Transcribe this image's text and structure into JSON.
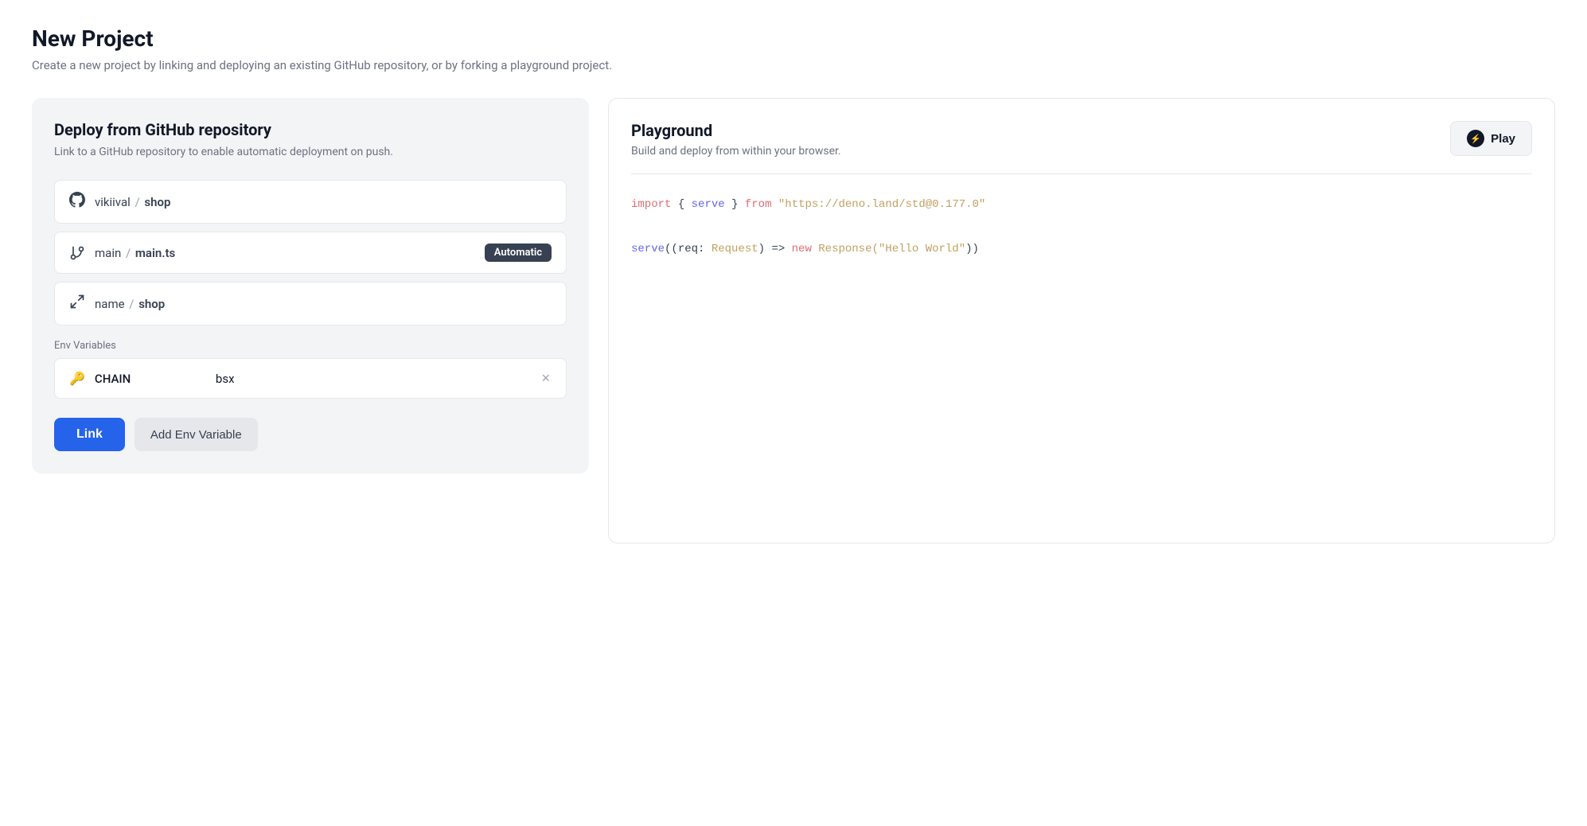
{
  "page": {
    "title": "New Project",
    "subtitle": "Create a new project by linking and deploying an existing GitHub repository, or by forking a playground project."
  },
  "left_panel": {
    "title": "Deploy from GitHub repository",
    "subtitle": "Link to a GitHub repository to enable automatic deployment on push.",
    "repo_row": {
      "icon": "github",
      "user": "vikiival",
      "separator": "/",
      "repo": "shop"
    },
    "branch_row": {
      "icon": "branch",
      "branch": "main",
      "separator": "/",
      "file": "main.ts",
      "badge": "Automatic"
    },
    "name_row": {
      "icon": "rename",
      "key": "name",
      "separator": "/",
      "value": "shop"
    },
    "env_section_label": "Env Variables",
    "env_variable": {
      "key": "CHAIN",
      "value": "bsx"
    },
    "btn_link": "Link",
    "btn_add_env": "Add Env Variable"
  },
  "right_panel": {
    "title": "Playground",
    "subtitle": "Build and deploy from within your browser.",
    "btn_play": "Play",
    "code": {
      "line1_import": "import",
      "line1_brace_open": " { ",
      "line1_serve": "serve",
      "line1_brace_close": " }",
      "line1_from": " from ",
      "line1_url": "\"https://deno.land/std@0.177.0\"",
      "line2_serve": "serve",
      "line2_paren_open": "(",
      "line2_param1": "(req: ",
      "line2_type": "Request",
      "line2_param_close": ")",
      "line2_arrow": " => ",
      "line2_new": "new ",
      "line2_response": "Response",
      "line2_arg": "(\"Hello World\")",
      "line2_close": ")"
    }
  }
}
